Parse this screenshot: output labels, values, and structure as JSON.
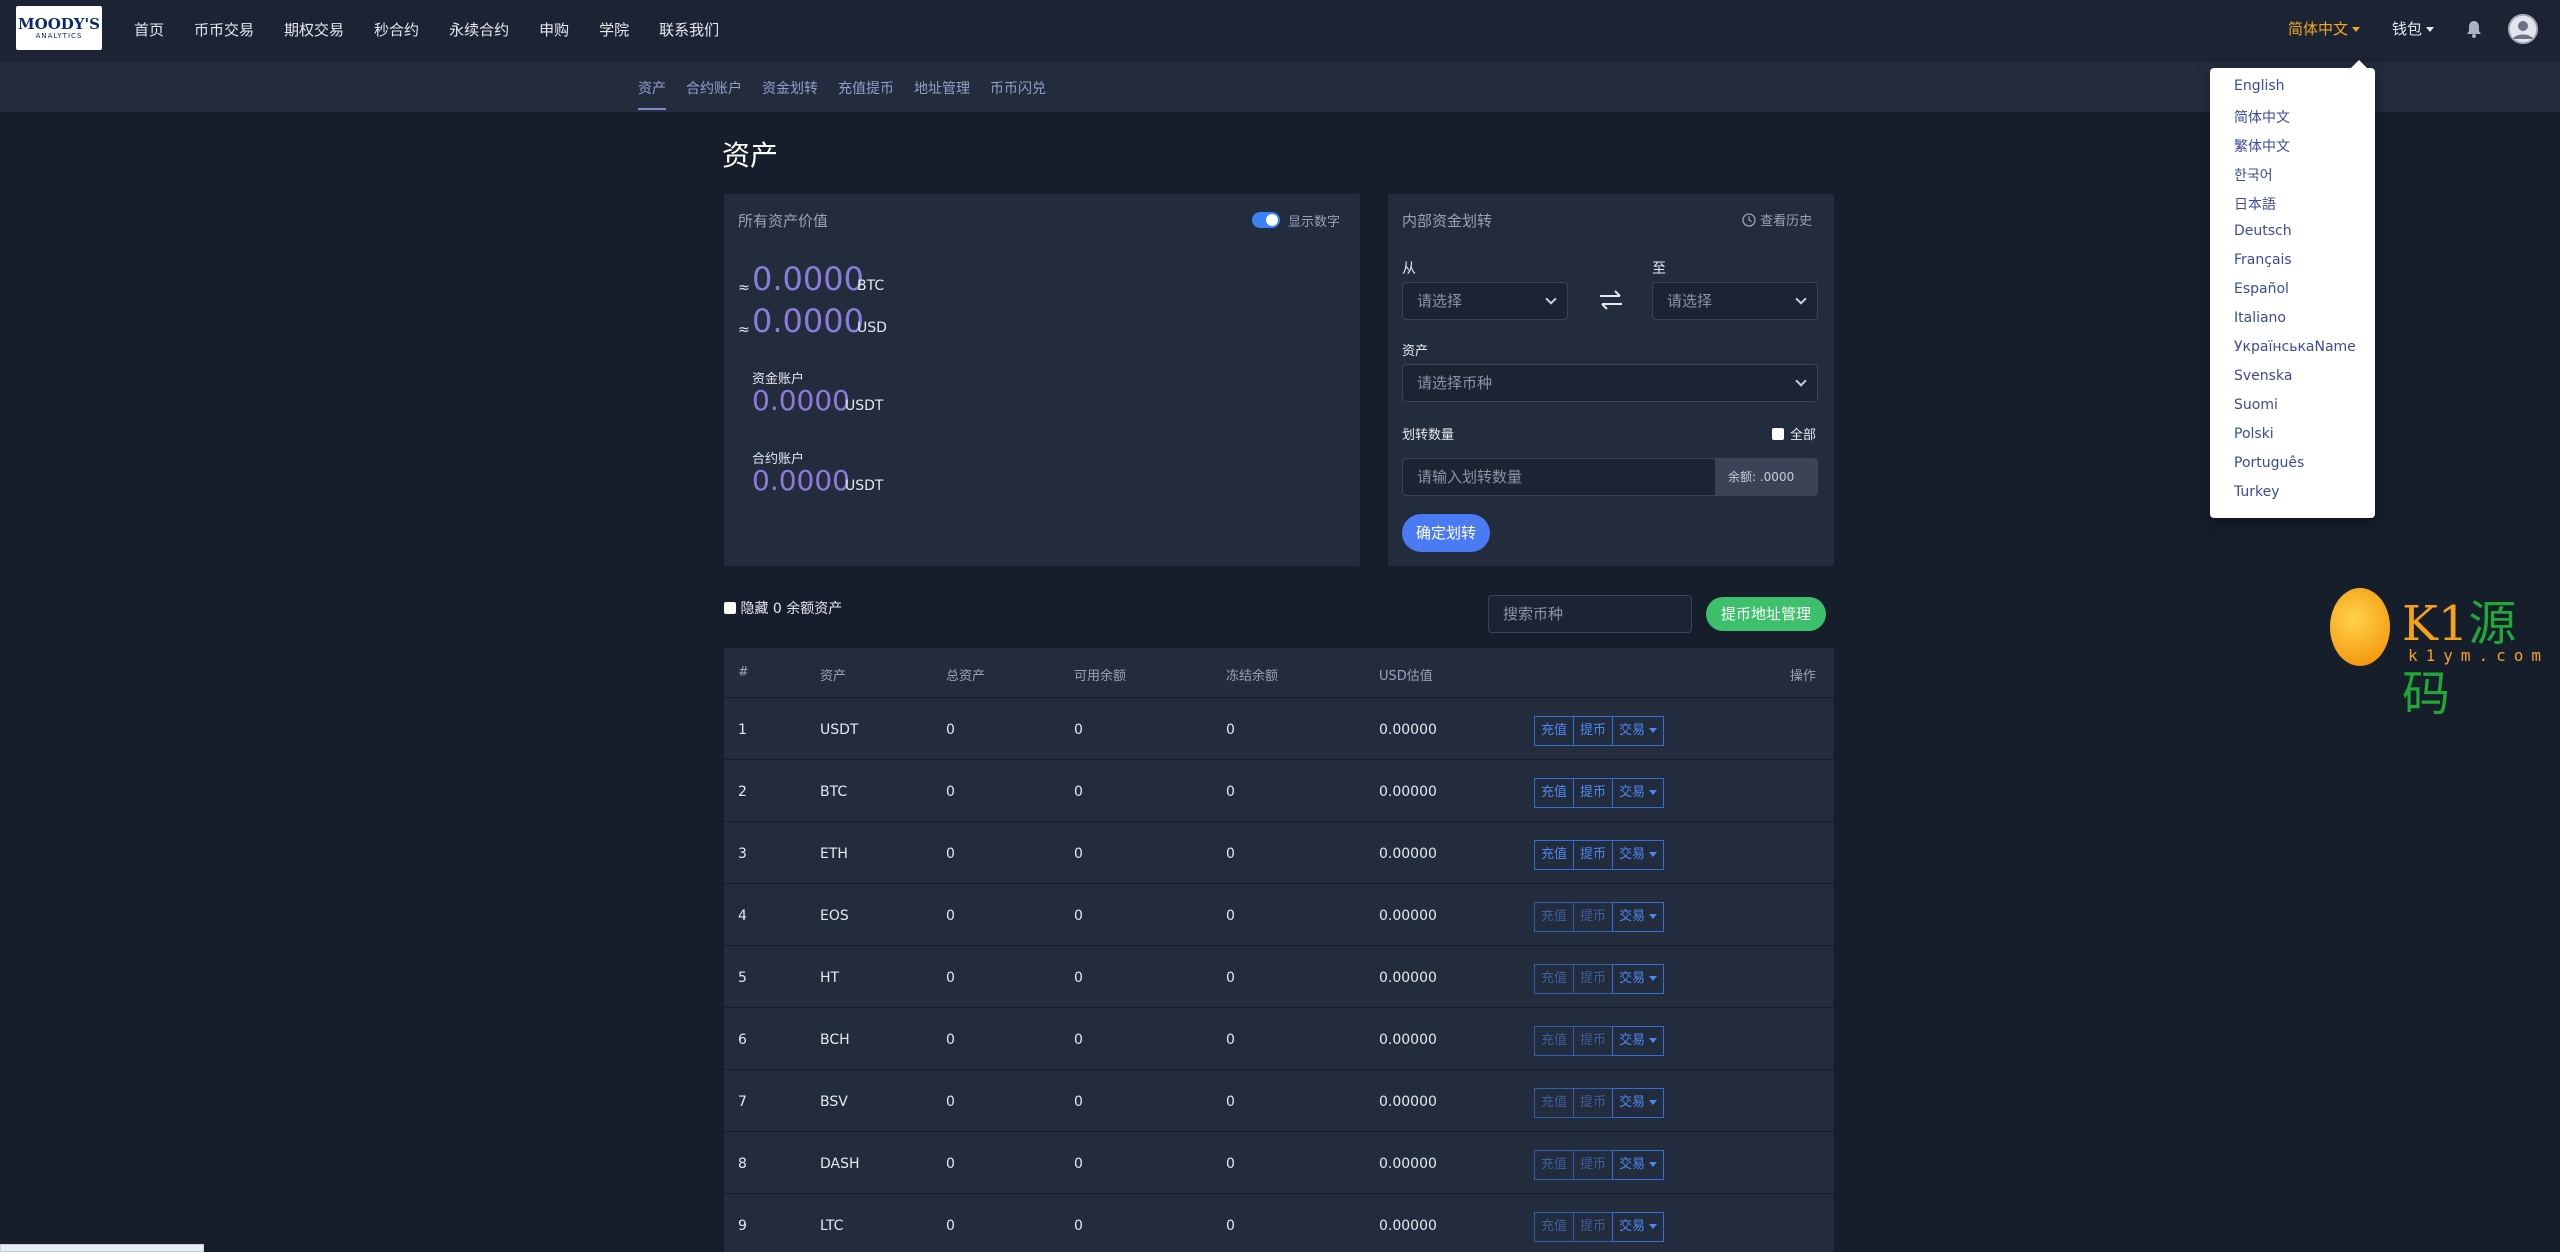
{
  "brand": {
    "line1": "MOODY'S",
    "line2": "ANALYTICS"
  },
  "nav": [
    "首页",
    "币币交易",
    "期权交易",
    "秒合约",
    "永续合约",
    "申购",
    "学院",
    "联系我们"
  ],
  "header": {
    "language": "简体中文",
    "wallet": "钱包"
  },
  "subnav": [
    "资产",
    "合约账户",
    "资金划转",
    "充值提币",
    "地址管理",
    "币币闪兑"
  ],
  "page_title": "资产",
  "assets_card": {
    "title": "所有资产价值",
    "toggle_label": "显示数字",
    "approx": "≈",
    "btc_value": "0.0000",
    "btc_unit": "BTC",
    "usd_value": "0.0000",
    "usd_unit": "USD",
    "fund_label": "资金账户",
    "fund_value": "0.0000",
    "fund_unit": "USDT",
    "contract_label": "合约账户",
    "contract_value": "0.0000",
    "contract_unit": "USDT"
  },
  "transfer_card": {
    "title": "内部资金划转",
    "history": "查看历史",
    "from_label": "从",
    "to_label": "至",
    "from_placeholder": "请选择",
    "to_placeholder": "请选择",
    "asset_label": "资产",
    "asset_placeholder": "请选择币种",
    "amount_label": "划转数量",
    "all_label": "全部",
    "amount_placeholder": "请输入划转数量",
    "balance_label": "余额: .0000",
    "confirm": "确定划转"
  },
  "filter": {
    "hide_zero": "隐藏 0 余额资产",
    "search_placeholder": "搜索币种",
    "address_mgmt": "提币地址管理"
  },
  "table": {
    "headers": [
      "#",
      "资产",
      "总资产",
      "可用余额",
      "冻结余额",
      "USD估值",
      "操作"
    ],
    "rows": [
      {
        "idx": "1",
        "asset": "USDT",
        "total": "0",
        "available": "0",
        "frozen": "0",
        "usd": "0.00000"
      },
      {
        "idx": "2",
        "asset": "BTC",
        "total": "0",
        "available": "0",
        "frozen": "0",
        "usd": "0.00000"
      },
      {
        "idx": "3",
        "asset": "ETH",
        "total": "0",
        "available": "0",
        "frozen": "0",
        "usd": "0.00000"
      },
      {
        "idx": "4",
        "asset": "EOS",
        "total": "0",
        "available": "0",
        "frozen": "0",
        "usd": "0.00000"
      },
      {
        "idx": "5",
        "asset": "HT",
        "total": "0",
        "available": "0",
        "frozen": "0",
        "usd": "0.00000"
      },
      {
        "idx": "6",
        "asset": "BCH",
        "total": "0",
        "available": "0",
        "frozen": "0",
        "usd": "0.00000"
      },
      {
        "idx": "7",
        "asset": "BSV",
        "total": "0",
        "available": "0",
        "frozen": "0",
        "usd": "0.00000"
      },
      {
        "idx": "8",
        "asset": "DASH",
        "total": "0",
        "available": "0",
        "frozen": "0",
        "usd": "0.00000"
      },
      {
        "idx": "9",
        "asset": "LTC",
        "total": "0",
        "available": "0",
        "frozen": "0",
        "usd": "0.00000"
      }
    ],
    "actions": {
      "deposit": "充值",
      "withdraw": "提币",
      "trade": "交易"
    }
  },
  "languages": [
    "English",
    "简体中文",
    "繁体中文",
    "한국어",
    "日本語",
    "Deutsch",
    "Français",
    "Español",
    "Italiano",
    "УкраїнськаName",
    "Svenska",
    "Suomi",
    "Polski",
    "Português",
    "Turkey"
  ],
  "watermark": {
    "brand": "K1",
    "brand_cn": "源码",
    "domain": "k1ym.com"
  },
  "colors": {
    "accent": "#f5a623",
    "value_purple": "#8a7cd8",
    "primary": "#4a7bf2",
    "success": "#3dbf6b"
  }
}
